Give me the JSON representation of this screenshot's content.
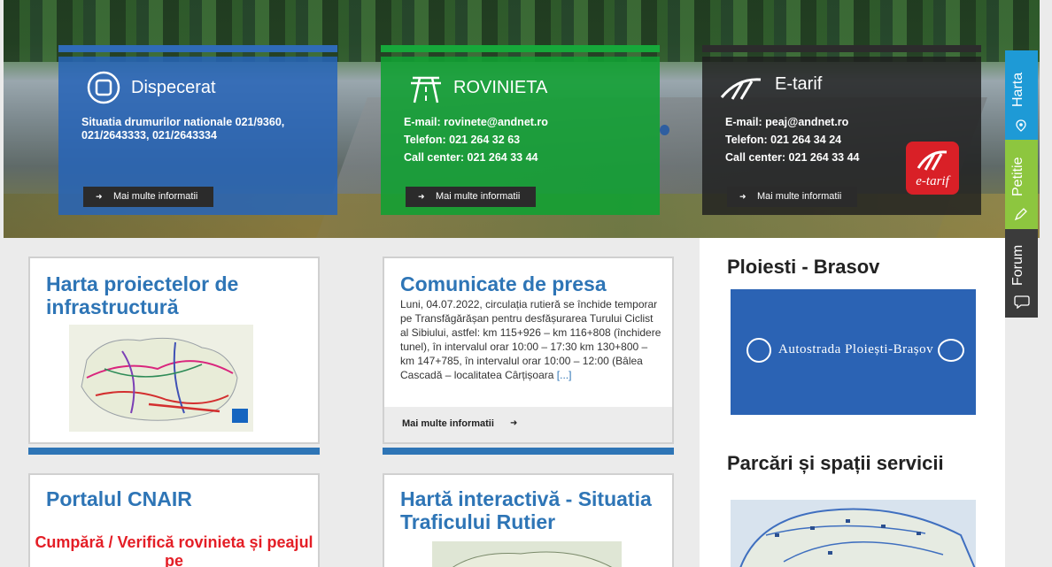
{
  "hero": {
    "cards": [
      {
        "title": "Dispecerat",
        "lines": [
          "Situatia drumurilor nationale 021/9360,",
          "021/2643333, 021/2643334"
        ],
        "button": "Mai multe informatii"
      },
      {
        "title": "ROVINIETA",
        "lines": [
          "E-mail: rovinete@andnet.ro",
          "Telefon: 021 264 32 63",
          "Call center: 021 264 33 44"
        ],
        "button": "Mai multe informatii"
      },
      {
        "title": "E-tarif",
        "lines": [
          "E-mail: peaj@andnet.ro",
          "Telefon: 021 264 34 24",
          "Call center: 021 264 33 44"
        ],
        "button": "Mai multe informatii",
        "logo_text": "e-tarif"
      }
    ]
  },
  "side_tabs": {
    "harta": "Harta",
    "petitie": "Petitie",
    "forum": "Forum"
  },
  "main": {
    "harta_proiecte": {
      "title": "Harta proiectelor de infrastructură"
    },
    "comunicate": {
      "title": "Comunicate de presa",
      "text": "Luni, 04.07.2022, circulația rutieră se închide temporar pe Transfăgărășan pentru desfășurarea Turului Ciclist al Sibiului, astfel: km 115+926 – km 116+808 (închidere tunel), în intervalul orar 10:00 – 17:30 km 130+800 – km 147+785, în intervalul orar 10:00 – 12:00 (Bâlea Cascadă – localitatea Cârțișoara",
      "more": "[...]",
      "button": "Mai multe informatii"
    },
    "portal": {
      "title": "Portalul CNAIR",
      "promo": "Cumpără / Verifică rovinieta și peajul pe"
    },
    "harta_interactiva": {
      "title": "Hartă interactivă - Situatia Traficului Rutier"
    }
  },
  "right": {
    "ploiesti": {
      "title": "Ploiesti - Brasov",
      "banner_text": "Autostrada Ploiești-Brașov"
    },
    "parcari": {
      "title": "Parcări și spații servicii"
    }
  },
  "colors": {
    "blue": "#2e75b6",
    "green": "#16a83a",
    "red": "#e41e26",
    "harta_tab": "#1e9ad6",
    "petitie_tab": "#8dc63f"
  }
}
